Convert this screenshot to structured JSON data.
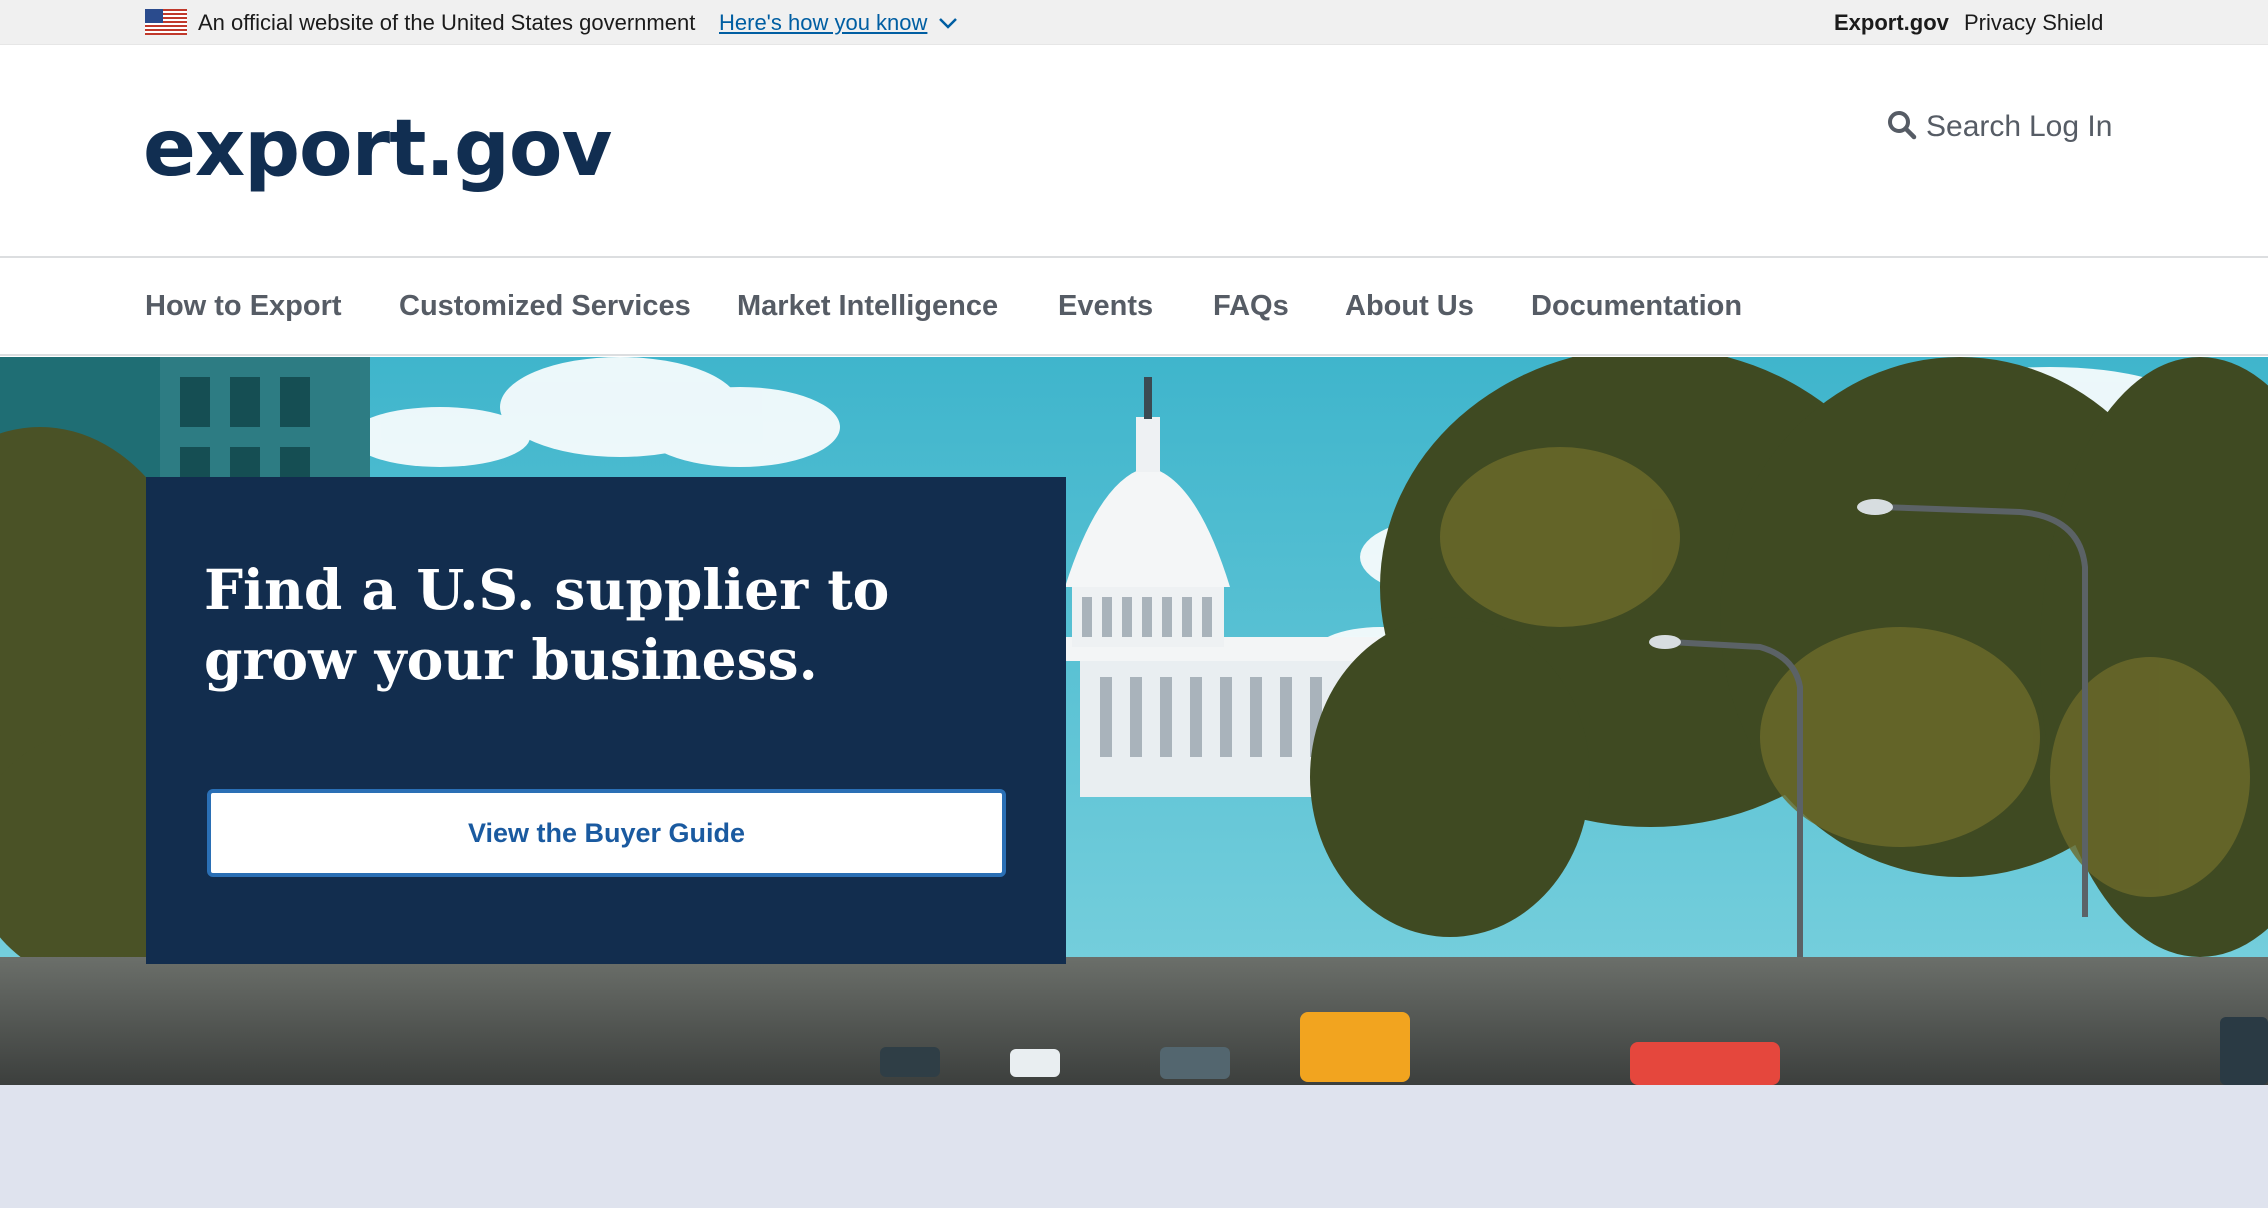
{
  "gov_banner": {
    "official_text": "An official website of the United States government",
    "how_link": "Here's how you know",
    "site_links": [
      "Export.gov",
      "Privacy Shield"
    ]
  },
  "header": {
    "logo": "export.gov",
    "search_label": "Search",
    "login_label": "Log In"
  },
  "nav": {
    "items": [
      "How to Export",
      "Customized Services",
      "Market Intelligence",
      "Events",
      "FAQs",
      "About Us",
      "Documentation"
    ]
  },
  "hero": {
    "title": "Find a U.S. supplier to grow your business.",
    "button_label": "View the Buyer Guide"
  },
  "colors": {
    "brand_navy": "#112e51",
    "card_navy": "#122d4e",
    "link_blue": "#005ea2",
    "nav_gray": "#565c65",
    "sky": "#41b9cf",
    "band": "#dfe3ee"
  }
}
